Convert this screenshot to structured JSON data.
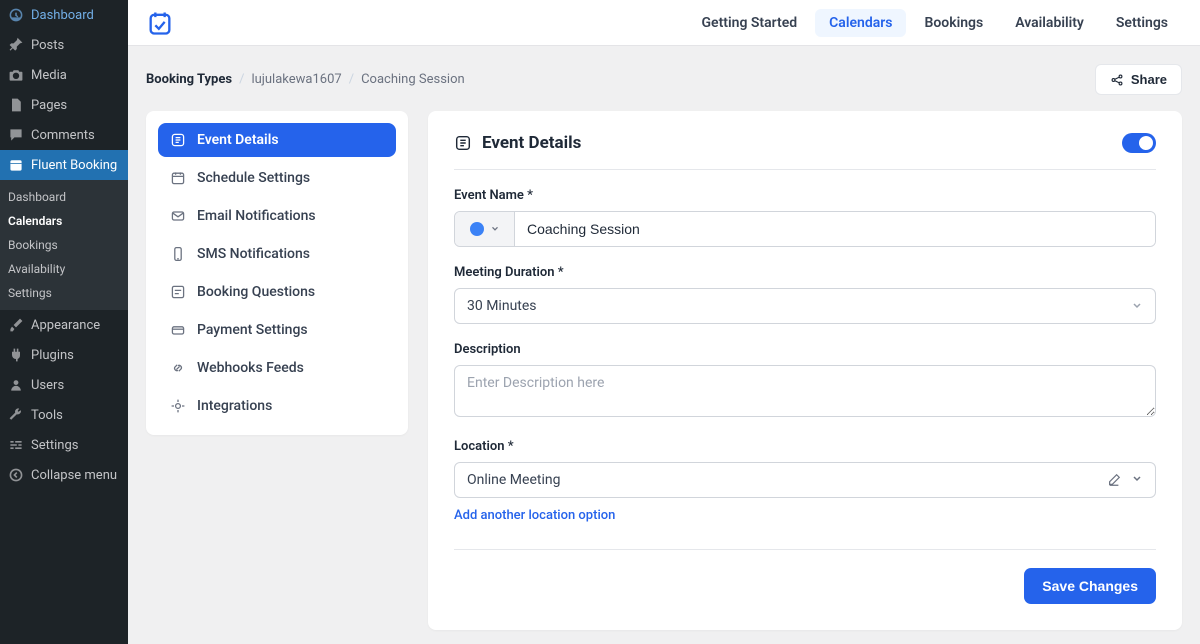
{
  "wp_sidebar": {
    "items": [
      {
        "label": "Dashboard",
        "icon": "gauge"
      },
      {
        "label": "Posts",
        "icon": "pin"
      },
      {
        "label": "Media",
        "icon": "camera"
      },
      {
        "label": "Pages",
        "icon": "page"
      },
      {
        "label": "Comments",
        "icon": "comment"
      },
      {
        "label": "Fluent Booking",
        "icon": "cal"
      },
      {
        "label": "Appearance",
        "icon": "brush"
      },
      {
        "label": "Plugins",
        "icon": "plug"
      },
      {
        "label": "Users",
        "icon": "user"
      },
      {
        "label": "Tools",
        "icon": "wrench"
      },
      {
        "label": "Settings",
        "icon": "sliders"
      },
      {
        "label": "Collapse menu",
        "icon": "collapse"
      }
    ],
    "sub_items": [
      "Dashboard",
      "Calendars",
      "Bookings",
      "Availability",
      "Settings"
    ]
  },
  "topnav": {
    "items": [
      "Getting Started",
      "Calendars",
      "Bookings",
      "Availability",
      "Settings"
    ]
  },
  "breadcrumb": {
    "root": "Booking Types",
    "mid": "lujulakewa1607",
    "leaf": "Coaching Session"
  },
  "share_label": "Share",
  "side_tabs": [
    {
      "label": "Event Details"
    },
    {
      "label": "Schedule Settings"
    },
    {
      "label": "Email Notifications"
    },
    {
      "label": "SMS Notifications"
    },
    {
      "label": "Booking Questions"
    },
    {
      "label": "Payment Settings"
    },
    {
      "label": "Webhooks Feeds"
    },
    {
      "label": "Integrations"
    }
  ],
  "panel": {
    "title": "Event Details",
    "event_name_label": "Event Name *",
    "event_name_value": "Coaching Session",
    "duration_label": "Meeting Duration *",
    "duration_value": "30 Minutes",
    "description_label": "Description",
    "description_placeholder": "Enter Description here",
    "location_label": "Location *",
    "location_value": "Online Meeting",
    "add_location": "Add another location option",
    "save_label": "Save Changes"
  }
}
